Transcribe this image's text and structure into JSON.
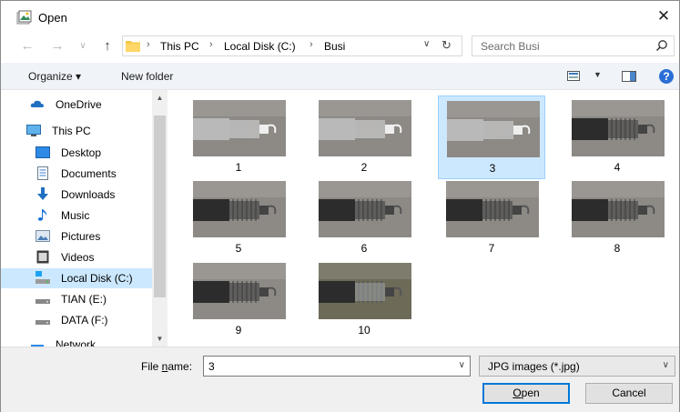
{
  "window": {
    "title": "Open"
  },
  "address": {
    "crumbs": [
      "This PC",
      "Local Disk (C:)",
      "Busi"
    ],
    "separator": "›"
  },
  "search": {
    "placeholder": "Search Busi"
  },
  "toolbar": {
    "organize_label": "Organize ▾",
    "new_folder_label": "New folder"
  },
  "sidebar": {
    "items": [
      {
        "label": "OneDrive",
        "icon": "cloud-icon"
      },
      {
        "label": "This PC",
        "icon": "computer-icon"
      },
      {
        "label": "Desktop",
        "icon": "desktop-icon"
      },
      {
        "label": "Documents",
        "icon": "documents-icon"
      },
      {
        "label": "Downloads",
        "icon": "downloads-icon"
      },
      {
        "label": "Music",
        "icon": "music-icon"
      },
      {
        "label": "Pictures",
        "icon": "pictures-icon"
      },
      {
        "label": "Videos",
        "icon": "videos-icon"
      },
      {
        "label": "Local Disk (C:)",
        "icon": "disk-icon",
        "selected": true
      },
      {
        "label": "TIAN (E:)",
        "icon": "drive-icon"
      },
      {
        "label": "DATA (F:)",
        "icon": "drive-icon"
      },
      {
        "label": "Network",
        "icon": "network-icon"
      }
    ]
  },
  "files": [
    {
      "name": "1",
      "selected": false
    },
    {
      "name": "2",
      "selected": false
    },
    {
      "name": "3",
      "selected": true
    },
    {
      "name": "4",
      "selected": false
    },
    {
      "name": "5",
      "selected": false
    },
    {
      "name": "6",
      "selected": false
    },
    {
      "name": "7",
      "selected": false
    },
    {
      "name": "8",
      "selected": false
    },
    {
      "name": "9",
      "selected": false
    },
    {
      "name": "10",
      "selected": false
    }
  ],
  "bottom": {
    "file_name_label_pre": "File ",
    "file_name_label_u": "n",
    "file_name_label_post": "ame:",
    "file_name_value": "3",
    "file_type": "JPG images (*.jpg)",
    "open_label_u": "O",
    "open_label_rest": "pen",
    "cancel_label": "Cancel"
  },
  "colors": {
    "selection": "#cce8ff",
    "accent": "#0078d7",
    "toolbar_bg": "#f0f4f9"
  }
}
